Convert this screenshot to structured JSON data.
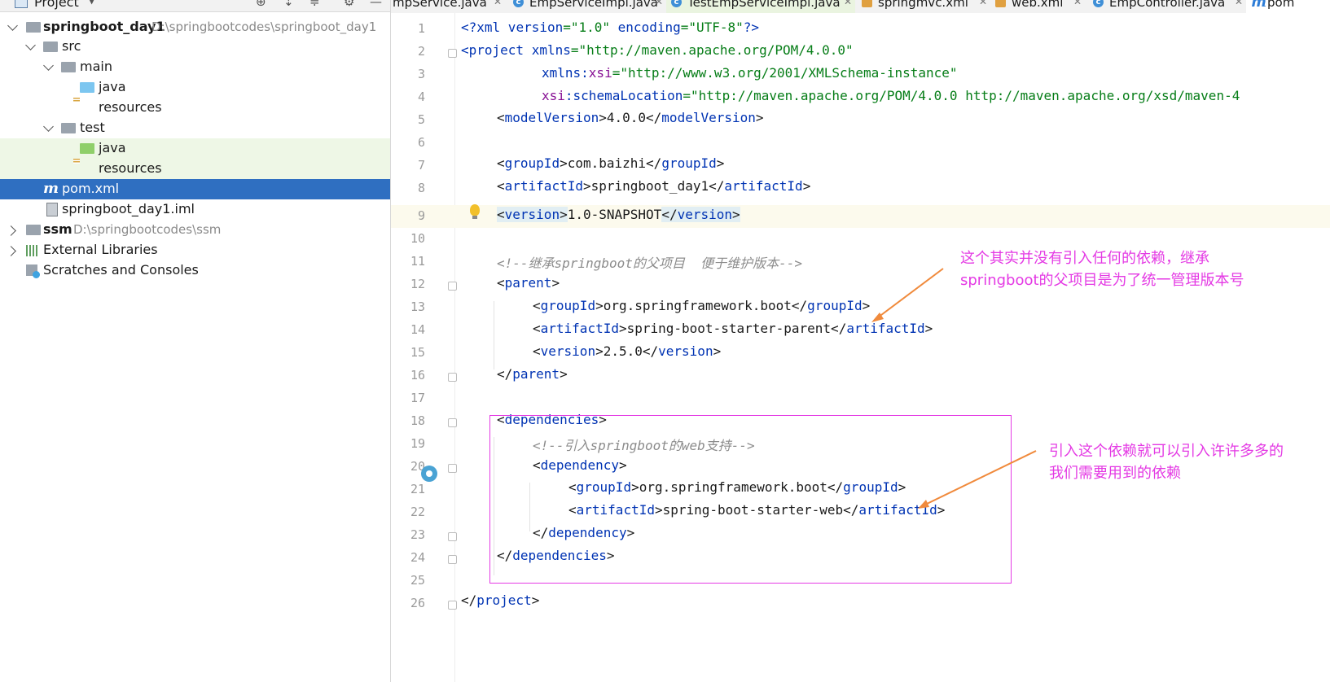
{
  "project_panel": {
    "title": "Project",
    "tree": [
      {
        "label": "springboot_day1",
        "path": "D:\\springbootcodes\\springboot_day1"
      },
      {
        "label": "src"
      },
      {
        "label": "main"
      },
      {
        "label": "java"
      },
      {
        "label": "resources"
      },
      {
        "label": "test"
      },
      {
        "label": "java"
      },
      {
        "label": "resources"
      },
      {
        "label": "pom.xml"
      },
      {
        "label": "springboot_day1.iml"
      },
      {
        "label": "ssm",
        "path": "D:\\springbootcodes\\ssm"
      },
      {
        "label": "External Libraries"
      },
      {
        "label": "Scratches and Consoles"
      }
    ]
  },
  "tabs": [
    {
      "label": "mpService.java"
    },
    {
      "label": "EmpServiceImpl.java"
    },
    {
      "label": "TestEmpServiceImpl.java"
    },
    {
      "label": "springmvc.xml"
    },
    {
      "label": "web.xml"
    },
    {
      "label": "EmpController.java"
    },
    {
      "label": "pom"
    }
  ],
  "editor": {
    "line_numbers": [
      "1",
      "2",
      "3",
      "4",
      "5",
      "6",
      "7",
      "8",
      "9",
      "10",
      "11",
      "12",
      "13",
      "14",
      "15",
      "16",
      "17",
      "18",
      "19",
      "20",
      "21",
      "22",
      "23",
      "24",
      "25",
      "26"
    ],
    "code": {
      "l1": {
        "a": "<?",
        "b": "xml",
        "c": " version",
        "d": "=\"1.0\"",
        "e": " encoding",
        "f": "=\"UTF-8\"",
        "g": "?>"
      },
      "l2": {
        "a": "<project ",
        "b": "xmlns",
        "c": "=\"http://maven.apache.org/POM/4.0.0\""
      },
      "l3": {
        "a": "xmlns:",
        "b": "xsi",
        "c": "=\"http://www.w3.org/2001/XMLSchema-instance\""
      },
      "l4": {
        "a": "xsi",
        "b": ":schemaLocation",
        "c": "=\"http://maven.apache.org/POM/4.0.0 http://maven.apache.org/xsd/maven-4"
      },
      "l5": {
        "a": "<",
        "b": "modelVersion",
        "c": ">4.0.0</",
        "d": "modelVersion",
        "e": ">"
      },
      "l7": {
        "a": "<",
        "b": "groupId",
        "c": ">com.baizhi</",
        "d": "groupId",
        "e": ">"
      },
      "l8": {
        "a": "<",
        "b": "artifactId",
        "c": ">springboot_day1</",
        "d": "artifactId",
        "e": ">"
      },
      "l9": {
        "a": "<",
        "b": "version",
        "c": ">",
        "d": "1.0-SNAPSHOT",
        "e": "</",
        "f": "version",
        "g": ">"
      },
      "l11": {
        "a": "<!--继承springboot的父项目  便于维护版本-->"
      },
      "l12": {
        "a": "<",
        "b": "parent",
        "c": ">"
      },
      "l13": {
        "a": "<",
        "b": "groupId",
        "c": ">org.springframework.boot</",
        "d": "groupId",
        "e": ">"
      },
      "l14": {
        "a": "<",
        "b": "artifactId",
        "c": ">spring-boot-starter-parent</",
        "d": "artifactId",
        "e": ">"
      },
      "l15": {
        "a": "<",
        "b": "version",
        "c": ">2.5.0</",
        "d": "version",
        "e": ">"
      },
      "l16": {
        "a": "</",
        "b": "parent",
        "c": ">"
      },
      "l18": {
        "a": "<",
        "b": "dependencies",
        "c": ">"
      },
      "l19": {
        "a": "<!--引入springboot的web支持-->"
      },
      "l20": {
        "a": "<",
        "b": "dependency",
        "c": ">"
      },
      "l21": {
        "a": "<",
        "b": "groupId",
        "c": ">org.springframework.boot</",
        "d": "groupId",
        "e": ">"
      },
      "l22": {
        "a": "<",
        "b": "artifactId",
        "c": ">spring-boot-starter-web</",
        "d": "artifactId",
        "e": ">"
      },
      "l23": {
        "a": "</",
        "b": "dependency",
        "c": ">"
      },
      "l24": {
        "a": "</",
        "b": "dependencies",
        "c": ">"
      },
      "l26": {
        "a": "</",
        "b": "project",
        "c": ">"
      }
    }
  },
  "annotations": {
    "note1_line1": "这个其实并没有引入任何的依赖，继承",
    "note1_line2": "springboot的父项目是为了统一管理版本号",
    "note2_line1": "引入这个依赖就可以引入许许多多的",
    "note2_line2": "我们需要用到的依赖"
  },
  "colors": {
    "annotation": "#e43ae4",
    "selection": "#2f6fc1",
    "arrow": "#f08a3c"
  }
}
